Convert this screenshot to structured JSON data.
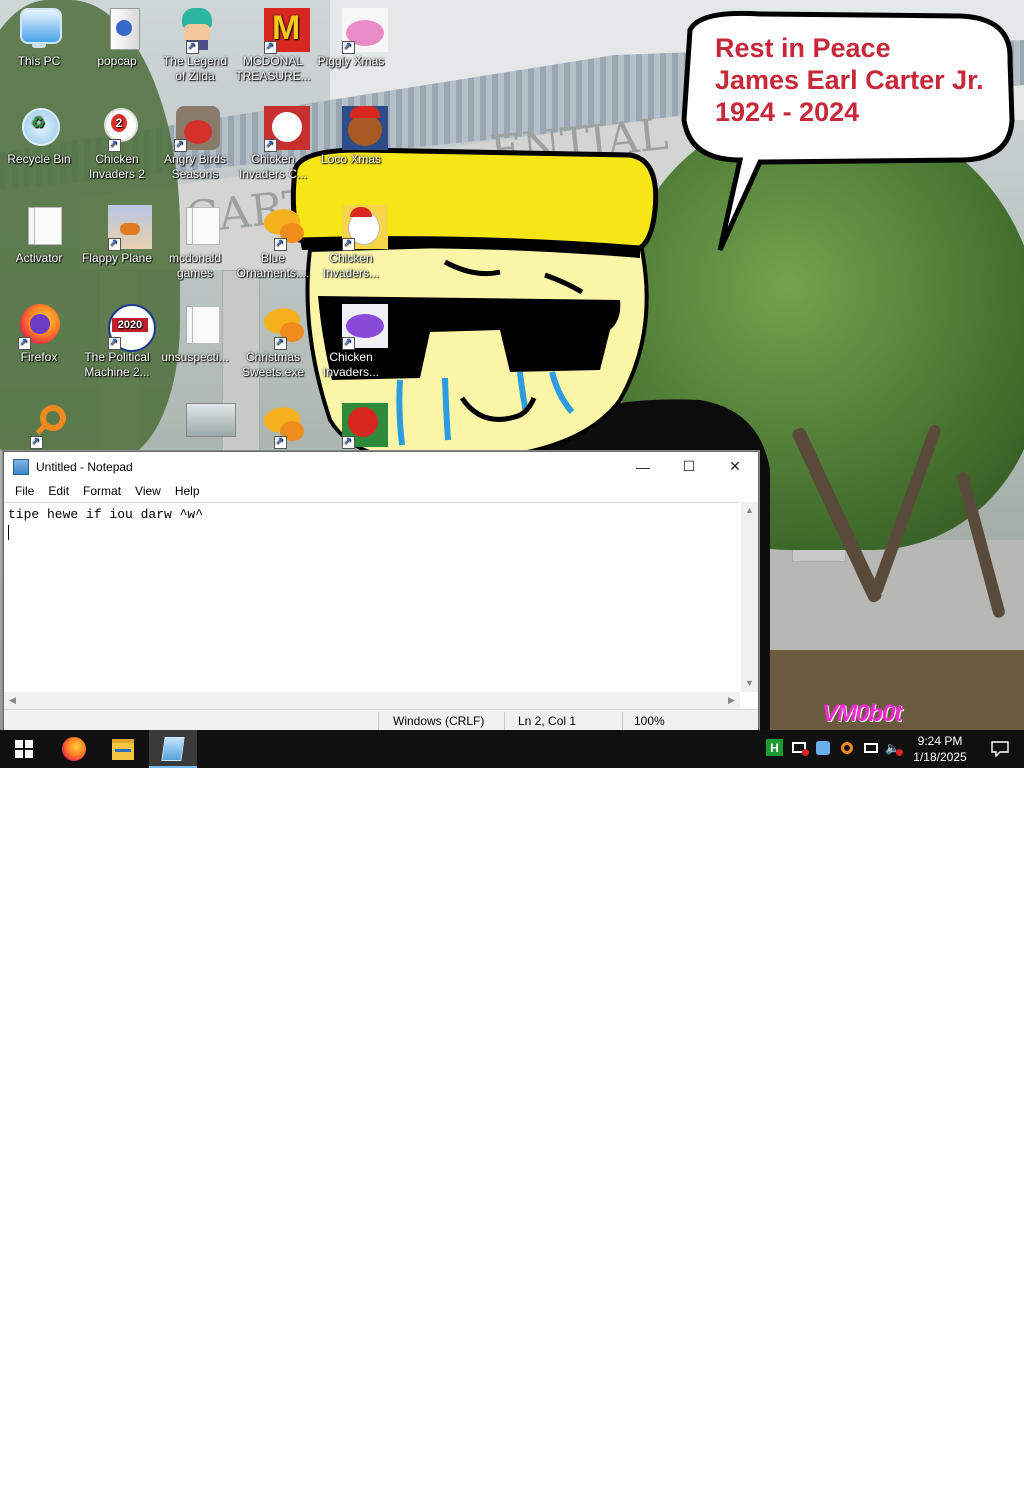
{
  "wallpaper": {
    "bubble_lines": [
      "Rest in Peace",
      "James Earl Carter Jr.",
      "1924 - 2024"
    ],
    "building_text_1": "ENTIAL",
    "building_text_2": "CARTE",
    "watermark": "VM0b0t"
  },
  "desktop_icons": [
    {
      "label": "This PC",
      "icon": "computer-icon"
    },
    {
      "label": "popcap",
      "icon": "folder-icon"
    },
    {
      "label": "The Legend of Zilda",
      "icon": "game-icon"
    },
    {
      "label": "MCDONAL TREASURE...",
      "icon": "mcdonalds-icon"
    },
    {
      "label": "Piggly Xmas",
      "icon": "pig-icon"
    },
    {
      "label": "Recycle Bin",
      "icon": "recycle-bin-icon"
    },
    {
      "label": "Chicken Invaders 2",
      "icon": "chicken-icon"
    },
    {
      "label": "Angry Birds Seasons",
      "icon": "angry-birds-icon"
    },
    {
      "label": "Chicken Invaders C...",
      "icon": "chicken-icon"
    },
    {
      "label": "Loco Xmas",
      "icon": "bear-icon"
    },
    {
      "label": "Activator",
      "icon": "file-icon"
    },
    {
      "label": "Flappy Plane",
      "icon": "plane-icon"
    },
    {
      "label": "mcdonald games",
      "icon": "file-icon"
    },
    {
      "label": "Blue Ornaments....",
      "icon": "ornaments-icon"
    },
    {
      "label": "Chicken Invaders...",
      "icon": "chicken-icon"
    },
    {
      "label": "Firefox",
      "icon": "firefox-icon"
    },
    {
      "label": "The Political Machine 2...",
      "icon": "political-machine-icon"
    },
    {
      "label": "unsuspecti...",
      "icon": "file-icon"
    },
    {
      "label": "Christmas Sweets.exe",
      "icon": "ornaments-icon"
    },
    {
      "label": "Chicken Invaders...",
      "icon": "chicken-icon"
    },
    {
      "label": "",
      "icon": "magnifier-icon"
    },
    {
      "label": "",
      "icon": "image-icon"
    },
    {
      "label": "",
      "icon": "ornaments-icon"
    },
    {
      "label": "",
      "icon": "chicken-icon"
    }
  ],
  "notepad": {
    "title": "Untitled - Notepad",
    "menu": [
      "File",
      "Edit",
      "Format",
      "View",
      "Help"
    ],
    "content_line": "tipe hewe if iou darw ^w^",
    "status": {
      "encoding": "Windows (CRLF)",
      "position": "Ln 2, Col 1",
      "zoom": "100%"
    },
    "buttons": {
      "minimize": "—",
      "maximize": "☐",
      "close": "✕"
    }
  },
  "taskbar": {
    "start_icon": "windows-logo-icon",
    "pinned": [
      "firefox-icon",
      "file-explorer-icon",
      "notepad-icon"
    ],
    "tray": [
      "h-app-icon",
      "monitor-icon",
      "network-status-icon",
      "magnifier-icon",
      "network-icon",
      "volume-muted-icon"
    ],
    "time": "9:24 PM",
    "date": "1/18/2025"
  }
}
